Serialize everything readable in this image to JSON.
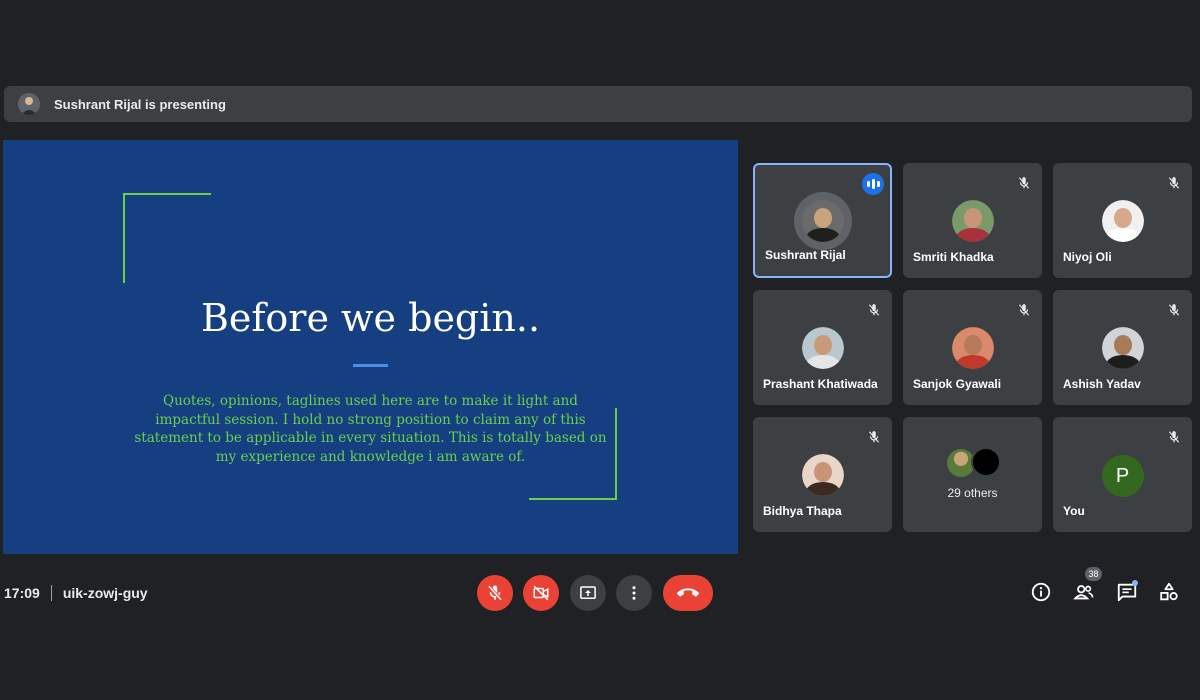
{
  "presenting_bar": {
    "text": "Sushrant Rijal is presenting"
  },
  "slide": {
    "title": "Before we begin..",
    "body": "Quotes, opinions, taglines used here are to make it light and impactful session. I hold no strong position to claim any of this statement to be applicable in every situation. This is totally based on my experience and knowledge i am aware of."
  },
  "participants": [
    {
      "name": "Sushrant Rijal",
      "speaking": true,
      "muted": false
    },
    {
      "name": "Smriti Khadka",
      "muted": true
    },
    {
      "name": "Niyoj Oli",
      "muted": true
    },
    {
      "name": "Prashant Khatiwada",
      "muted": true
    },
    {
      "name": "Sanjok Gyawali",
      "muted": true
    },
    {
      "name": "Ashish Yadav",
      "muted": true
    },
    {
      "name": "Bidhya Thapa",
      "muted": true
    },
    {
      "name": "You",
      "initial": "P",
      "muted": true
    }
  ],
  "others_tile": {
    "label": "29 others"
  },
  "meeting": {
    "time": "17:09",
    "code": "uik-zowj-guy"
  },
  "controls": [
    {
      "name": "mic-off",
      "icon": "mic-off-icon",
      "state": "off"
    },
    {
      "name": "camera-off",
      "icon": "videocam-off-icon",
      "state": "off"
    },
    {
      "name": "present",
      "icon": "present-to-all-icon"
    },
    {
      "name": "more-options",
      "icon": "more-vert-icon"
    },
    {
      "name": "leave-call",
      "icon": "call-end-icon"
    }
  ],
  "side_panel": {
    "people_count": "38",
    "icons": [
      "info-icon",
      "people-icon",
      "chat-icon",
      "activities-icon"
    ]
  },
  "colors": {
    "background": "#202124",
    "tile": "#3c4043",
    "slide_bg": "#153f80",
    "slide_accent": "#6ccf4a",
    "red": "#ea4335",
    "speaking": "#1a73e8"
  }
}
